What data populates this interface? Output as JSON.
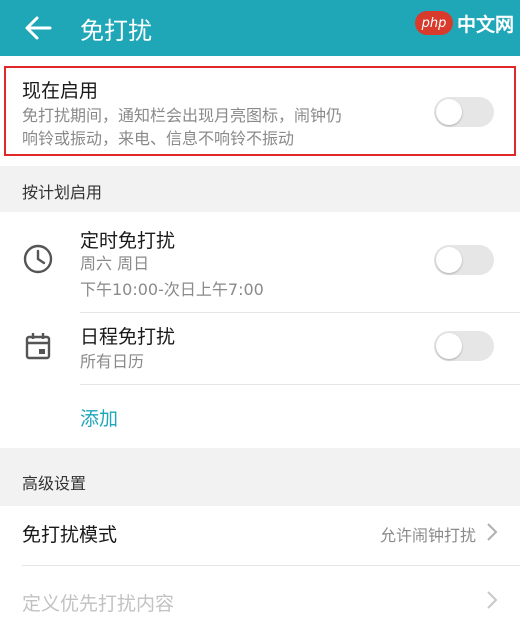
{
  "header": {
    "title": "免打扰",
    "back_icon": "arrow-left-icon",
    "watermark_logo": "php",
    "watermark_text": "中文网"
  },
  "now_enable": {
    "title": "现在启用",
    "desc_line1": "免打扰期间，通知栏会出现月亮图标，闹钟仍",
    "desc_line2": "响铃或振动，来电、信息不响铃不振动",
    "enabled": false
  },
  "schedule": {
    "section_label": "按计划启用",
    "timed": {
      "title": "定时免打扰",
      "days": "周六 周日",
      "time": "下午10:00-次日上午7:00",
      "icon": "clock-icon",
      "enabled": false
    },
    "calendar": {
      "title": "日程免打扰",
      "subtitle": "所有日历",
      "icon": "calendar-icon",
      "enabled": false
    },
    "add_label": "添加"
  },
  "advanced": {
    "section_label": "高级设置",
    "mode_label": "免打扰模式",
    "mode_value": "允许闹钟打扰",
    "priority_label": "定义优先打扰内容"
  },
  "colors": {
    "accent": "#1fa7b8",
    "highlight": "#e0282a",
    "toggle_off": "#e6e6e6"
  }
}
